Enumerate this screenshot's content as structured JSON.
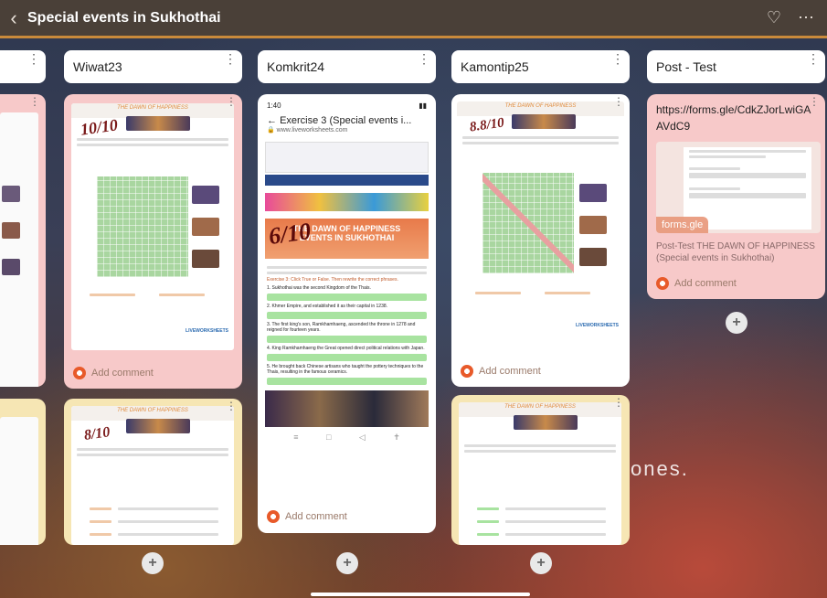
{
  "header": {
    "title": "Special events in Sukhothai",
    "back_icon": "chevron-left-icon",
    "heart_icon": "heart-icon",
    "more_icon": "more-icon"
  },
  "columns": [
    {
      "title": ""
    },
    {
      "title": "Wiwat23"
    },
    {
      "title": "Komkrit24"
    },
    {
      "title": "Kamontip25"
    },
    {
      "title": "Post - Test"
    }
  ],
  "cards": {
    "wiwat_top": {
      "score": "10/10",
      "brand": "LIVEWORKSHEETS"
    },
    "wiwat_bottom": {
      "score": "8/10"
    },
    "komkrit": {
      "score": "6/10",
      "time": "1:40",
      "page_title": "Exercise 3 (Special events i...",
      "url": "www.liveworksheets.com",
      "banner": "THE DAWN OF HAPPINESS",
      "banner_sub": "EVENTS IN SUKHOTHAI",
      "exercise": "Exercise 3: Click True or False. Then rewrite the correct phrases.",
      "q1": "1. Sukhothai was the second Kingdom of the Thais.",
      "q2": "2. Khmer Empire, and established it as their capital in 1238.",
      "q3": "3. The first king's son, Ramkhamhaeng, ascended the throne in 1278 and reigned for fourteen years.",
      "q4": "4. King Ramkhamhaeng the Great opened direct political relations with Japan.",
      "q5": "5. He brought back Chinese artisans who taught the pottery techniques to the Thais, resulting in the famous ceramics."
    },
    "kamontip_top": {
      "score": "8.8/10",
      "brand": "LIVEWORKSHEETS"
    },
    "kamontip_bottom": {
      "score": ""
    },
    "post_test": {
      "link": "https://forms.gle/CdkZJorLwiGAAVdC9",
      "domain": "forms.gle",
      "desc": "Post-Test THE DAWN OF HAPPINESS (Special events in Sukhothai)"
    }
  },
  "labels": {
    "add_comment": "Add comment"
  },
  "background_text": "ones.",
  "colors": {
    "topbar": "#4a4038",
    "accent": "#c98a3b",
    "card_pink": "#f7c9c9",
    "card_yellow": "#f6e6b4"
  }
}
